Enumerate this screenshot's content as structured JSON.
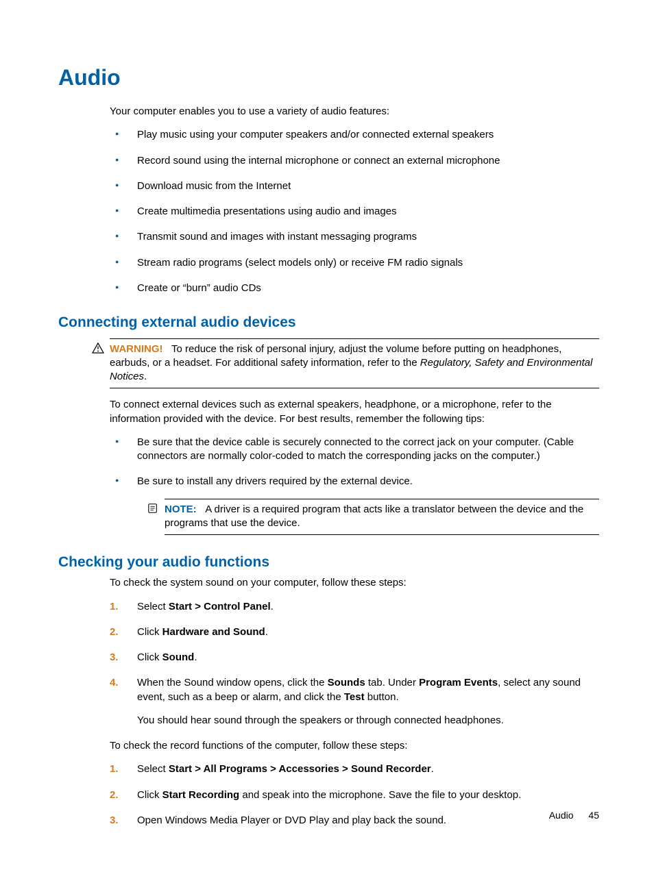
{
  "h1": "Audio",
  "intro": "Your computer enables you to use a variety of audio features:",
  "features": [
    "Play music using your computer speakers and/or connected external speakers",
    "Record sound using the internal microphone or connect an external microphone",
    "Download music from the Internet",
    "Create multimedia presentations using audio and images",
    "Transmit sound and images with instant messaging programs",
    "Stream radio programs (select models only) or receive FM radio signals",
    "Create or “burn” audio CDs"
  ],
  "sec1": {
    "title": "Connecting external audio devices",
    "warnLabel": "WARNING!",
    "warnText1": "To reduce the risk of personal injury, adjust the volume before putting on headphones, earbuds, or a headset. For additional safety information, refer to the ",
    "warnItalic": "Regulatory, Safety and Environmental Notices",
    "warnText2": ".",
    "para": "To connect external devices such as external speakers, headphone, or a microphone, refer to the information provided with the device. For best results, remember the following tips:",
    "tips": [
      "Be sure that the device cable is securely connected to the correct jack on your computer. (Cable connectors are normally color-coded to match the corresponding jacks on the computer.)",
      "Be sure to install any drivers required by the external device."
    ],
    "noteLabel": "NOTE:",
    "noteText": "A driver is a required program that acts like a translator between the device and the programs that use the device."
  },
  "sec2": {
    "title": "Checking your audio functions",
    "intro": "To check the system sound on your computer, follow these steps:",
    "steps": [
      {
        "pre": "Select ",
        "bold": "Start > Control Panel",
        "post": "."
      },
      {
        "pre": "Click ",
        "bold": "Hardware and Sound",
        "post": "."
      },
      {
        "pre": "Click ",
        "bold": "Sound",
        "post": "."
      }
    ],
    "step4": {
      "t1": "When the Sound window opens, click the ",
      "b1": "Sounds",
      "t2": " tab. Under ",
      "b2": "Program Events",
      "t3": ", select any sound event, such as a beep or alarm, and click the ",
      "b3": "Test",
      "t4": " button.",
      "sub": "You should hear sound through the speakers or through connected headphones."
    },
    "intro2": "To check the record functions of the computer, follow these steps:",
    "rec": [
      {
        "pre": "Select ",
        "bold": "Start > All Programs > Accessories > Sound Recorder",
        "post": "."
      },
      {
        "pre": "Click ",
        "bold": "Start Recording",
        "post": " and speak into the microphone. Save the file to your desktop."
      },
      {
        "pre": "Open Windows Media Player or DVD Play and play back the sound.",
        "bold": "",
        "post": ""
      }
    ]
  },
  "footer": {
    "section": "Audio",
    "page": "45"
  }
}
